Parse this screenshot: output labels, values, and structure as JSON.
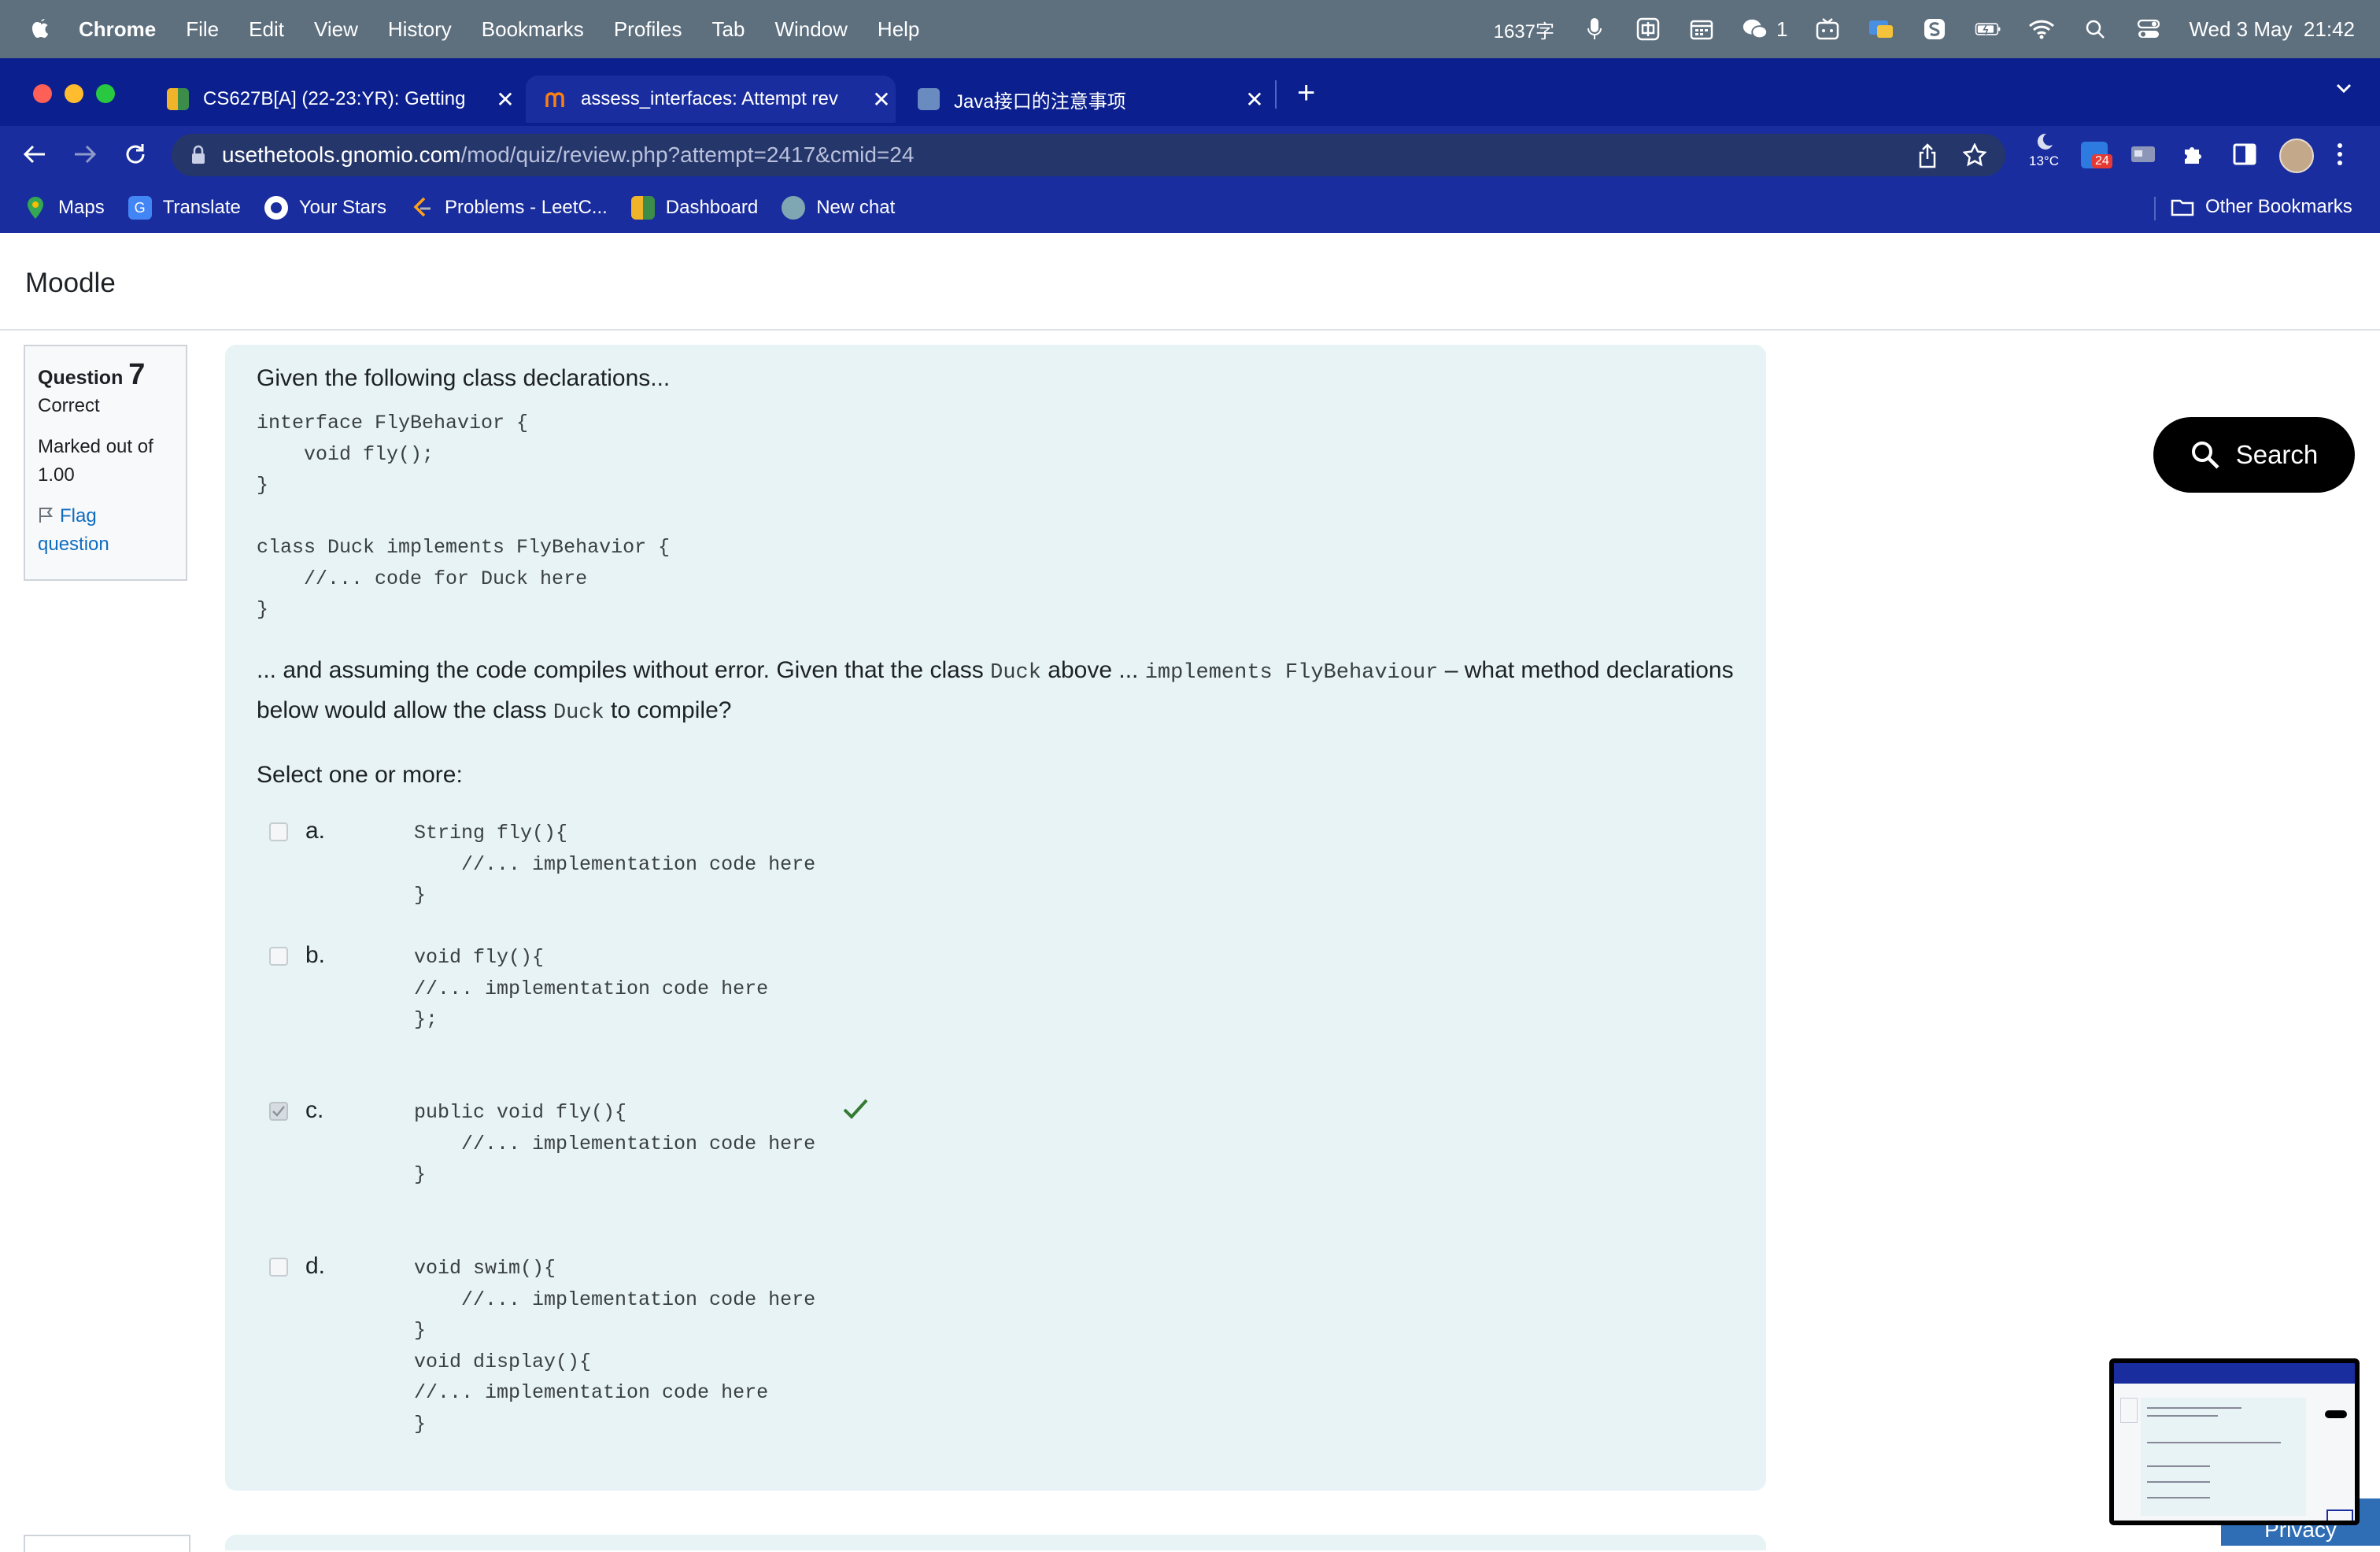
{
  "menubar": {
    "app": "Chrome",
    "items": [
      "File",
      "Edit",
      "View",
      "History",
      "Bookmarks",
      "Profiles",
      "Tab",
      "Window",
      "Help"
    ],
    "input_count": "1637字",
    "wechat_count": "1",
    "datetime": "Wed 3 May  21:42"
  },
  "tabs": [
    {
      "title": "CS627B[A] (22-23:YR): Getting"
    },
    {
      "title": "assess_interfaces: Attempt rev"
    },
    {
      "title": "Java接口的注意事项"
    }
  ],
  "address": {
    "domain": "usethetools.gnomio.com",
    "path": "/mod/quiz/review.php?attempt=2417&cmid=24"
  },
  "weather": "13°C",
  "ext_badge": "24",
  "bookmarks": [
    "Maps",
    "Translate",
    "Your Stars",
    "Problems - LeetC...",
    "Dashboard",
    "New chat"
  ],
  "other_bookmarks": "Other Bookmarks",
  "site_name": "Moodle",
  "question_info": {
    "label": "Question",
    "number": "7",
    "state": "Correct",
    "grade": "Marked out of 1.00",
    "flag": "Flag question"
  },
  "question": {
    "intro": "Given the following class declarations...",
    "code": "interface FlyBehavior {\n    void fly();\n}\n\nclass Duck implements FlyBehavior {\n    //... code for Duck here\n}",
    "para_1": "... and assuming the code compiles without error. Given that the class ",
    "code_1": "Duck",
    "para_2": " above ... ",
    "code_2": "implements FlyBehaviour",
    "para_3": " – what method declarations below would allow the class ",
    "code_3": "Duck",
    "para_4": " to compile?",
    "prompt": "Select one or more:",
    "options": [
      {
        "letter": "a.",
        "code": "String fly(){\n    //... implementation code here\n}",
        "checked": false
      },
      {
        "letter": "b.",
        "code": "void fly(){\n//... implementation code here\n};",
        "checked": false
      },
      {
        "letter": "c.",
        "code": "public void fly(){\n    //... implementation code here\n}",
        "checked": true
      },
      {
        "letter": "d.",
        "code": "void swim(){\n    //... implementation code here\n}\nvoid display(){\n//... implementation code here\n}",
        "checked": false
      }
    ]
  },
  "search_button": "Search",
  "privacy": "Privacy"
}
